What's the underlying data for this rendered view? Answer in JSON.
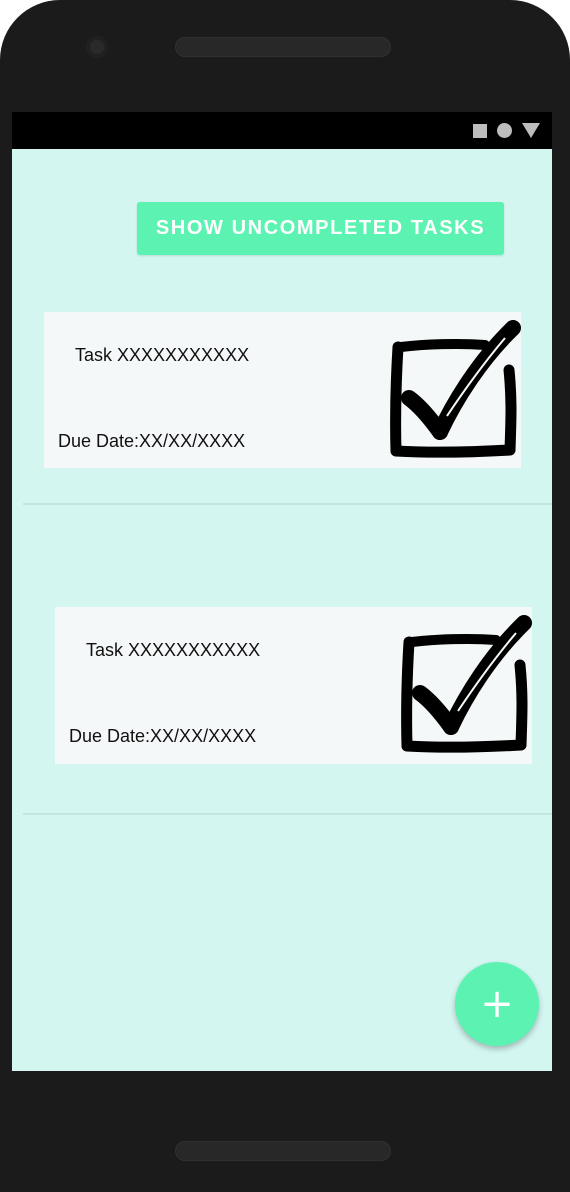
{
  "colors": {
    "accent": "#5cf3b2",
    "screen_background": "#d3f6f1",
    "card_background": "#f5f8f8",
    "divider": "#c4e6e1",
    "status_bar": "#000000"
  },
  "status_bar": {
    "icons": [
      "square-icon",
      "circle-icon",
      "triangle-icon"
    ]
  },
  "toolbar": {
    "show_uncompleted_label": "SHOW UNCOMPLETED TASKS"
  },
  "tasks": [
    {
      "name": "Task XXXXXXXXXXX",
      "due_date": "Due Date:XX/XX/XXXX",
      "completed": true,
      "icon": "checkbox-checked-icon"
    },
    {
      "name": "Task XXXXXXXXXXX",
      "due_date": "Due Date:XX/XX/XXXX",
      "completed": true,
      "icon": "checkbox-checked-icon"
    }
  ],
  "fab": {
    "label": "+",
    "icon": "add-icon"
  }
}
